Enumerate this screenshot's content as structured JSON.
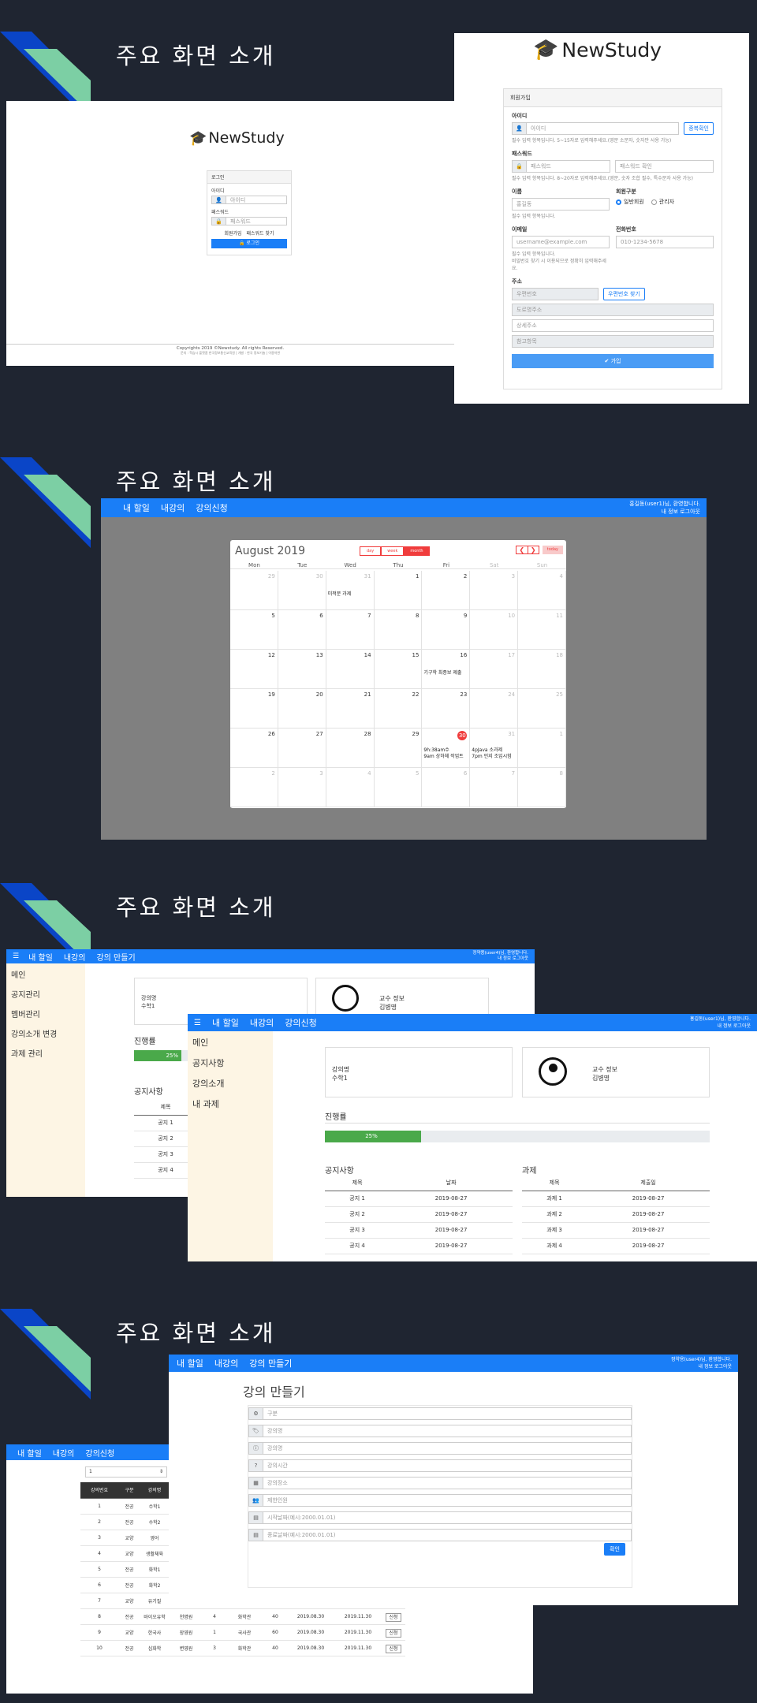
{
  "section_title": "주요 화면 소개",
  "brand": "NewStudy",
  "login": {
    "card_title": "로그인",
    "id_label": "아이디",
    "id_placeholder": "아이디",
    "pw_label": "패스워드",
    "pw_placeholder": "패스워드",
    "signup_link": "회원가입",
    "find_pw_link": "패스워드 찾기",
    "submit": "로그인",
    "footer": "Copyrights 2019 ©Newstudy. All rights Reserved.",
    "footer_sub": "문의 : 학습시 플랫폼 한국정보통신교육원 | 개발 : 한국 정보기술 | 이용약관"
  },
  "signup": {
    "card_title": "회원가입",
    "id_label": "아이디",
    "id_placeholder": "아이디",
    "dup_check": "중복확인",
    "id_help": "필수 입력 항목입니다. 5~15자로 입력해주세요.(영문 소문자, 숫자만 사용 가능)",
    "pw_label": "패스워드",
    "pw_placeholder": "패스워드",
    "pw_confirm_placeholder": "패스워드 확인",
    "pw_help": "필수 입력 항목입니다. 8~20자로 입력해주세요.(영문, 숫자 조합 필수, 특수문자 사용 가능)",
    "name_label": "이름",
    "name_value": "홍길동",
    "name_help": "필수 입력 항목입니다.",
    "type_label": "회원구분",
    "type_opt1": "일반회원",
    "type_opt2": "관리자",
    "email_label": "이메일",
    "email_placeholder": "username@example.com",
    "email_help": "필수 입력 항목입니다.",
    "email_help2": "비밀번호 찾기 시 이용되므로 정확히 입력해주세요.",
    "phone_label": "전화번호",
    "phone_placeholder": "010-1234-5678",
    "addr_label": "주소",
    "zip_placeholder": "우편번호",
    "zip_button": "우편번호 찾기",
    "road_placeholder": "도로명주소",
    "detail_placeholder": "상세주소",
    "extra_placeholder": "참고항목",
    "submit": "✔ 가입"
  },
  "nav_student": {
    "items": [
      "내 할일",
      "내강의",
      "강의신청"
    ],
    "welcome": "홍길동(user1)님, 환영합니다.",
    "links": "내 정보   로그아웃"
  },
  "nav_teacher": {
    "items": [
      "내 할일",
      "내강의",
      "강의 만들기"
    ],
    "welcome": "정약용(user4)님, 환영합니다.",
    "links": "내 정보   로그아웃"
  },
  "calendar": {
    "month": "August 2019",
    "views": [
      "day",
      "week",
      "month"
    ],
    "today": "today",
    "weekdays": [
      "Mon",
      "Tue",
      "Wed",
      "Thu",
      "Fri",
      "Sat",
      "Sun"
    ],
    "days": [
      [
        "29",
        "30",
        "31",
        "1",
        "2",
        "3",
        "4"
      ],
      [
        "5",
        "6",
        "7",
        "8",
        "9",
        "10",
        "11"
      ],
      [
        "12",
        "13",
        "14",
        "15",
        "16",
        "17",
        "18"
      ],
      [
        "19",
        "20",
        "21",
        "22",
        "23",
        "24",
        "25"
      ],
      [
        "26",
        "27",
        "28",
        "29",
        "30",
        "31",
        "1"
      ],
      [
        "2",
        "3",
        "4",
        "5",
        "6",
        "7",
        "8"
      ]
    ],
    "events": {
      "e1": "미적분 과제",
      "e2": "기구학 최종보 제출",
      "e3a": "9h:38am수",
      "e3b": "9am 상하체 작업트",
      "e4a": "4pJava 소과제",
      "e4b": "7pm 인지 조입시험"
    }
  },
  "course": {
    "sidebar_prof": [
      "메인",
      "공지관리",
      "멤버관리",
      "강의소개 변경",
      "과제 관리"
    ],
    "sidebar_student": [
      "메인",
      "공지사항",
      "강의소개",
      "내 과제"
    ],
    "course_label": "강의명",
    "course_name": "수학1",
    "prof_label": "교수 정보",
    "prof_name": "김병명",
    "progress_label": "진행률",
    "progress_value": "25%",
    "notice_title": "공지사항",
    "notice_cols": [
      "제목",
      "날짜"
    ],
    "notices": [
      [
        "공지 1",
        "2019-08-27"
      ],
      [
        "공지 2",
        "2019-08-27"
      ],
      [
        "공지 3",
        "2019-08-27"
      ],
      [
        "공지 4",
        "2019-08-27"
      ]
    ],
    "task_title": "과제",
    "task_cols": [
      "제목",
      "제출일"
    ],
    "tasks": [
      [
        "과제 1",
        "2019-08-27"
      ],
      [
        "과제 2",
        "2019-08-27"
      ],
      [
        "과제 3",
        "2019-08-27"
      ],
      [
        "과제 4",
        "2019-08-27"
      ]
    ]
  },
  "create": {
    "title": "강의 만들기",
    "fields": [
      "구분",
      "강의명",
      "강의명",
      "강의시간",
      "강의장소",
      "제한인원",
      "시작날짜(예시:2000.01.01)",
      "종료날짜(예시:2000.01.01)"
    ],
    "submit": "확인"
  },
  "apply": {
    "select": "1",
    "cols": [
      "강의번호",
      "구분",
      "강의명"
    ],
    "rows": [
      [
        "1",
        "전공",
        "수학1"
      ],
      [
        "2",
        "전공",
        "수학2"
      ],
      [
        "3",
        "교양",
        "영어"
      ],
      [
        "4",
        "교양",
        "생활체육"
      ],
      [
        "5",
        "전공",
        "화학1"
      ],
      [
        "6",
        "전공",
        "화학2"
      ],
      [
        "7",
        "교양",
        "유기질"
      ],
      [
        "8",
        "전공",
        "바이오유학",
        "천명원",
        "4",
        "화학관",
        "40",
        "2019.08.30",
        "2019.11.30",
        "신청"
      ],
      [
        "9",
        "교양",
        "한국사",
        "장영원",
        "1",
        "국사관",
        "60",
        "2019.08.30",
        "2019.11.30",
        "신청"
      ],
      [
        "10",
        "전공",
        "심화학",
        "변영원",
        "3",
        "화학관",
        "40",
        "2019.08.30",
        "2019.11.30",
        "신청"
      ]
    ]
  }
}
